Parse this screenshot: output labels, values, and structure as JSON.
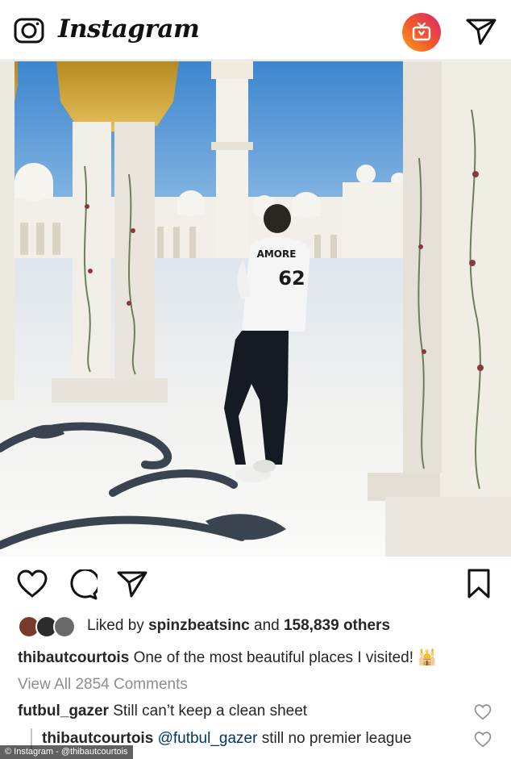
{
  "app": {
    "logo_text": "Instagram"
  },
  "post": {
    "likes": {
      "prefix": "Liked by",
      "user": "spinzbeatsinc",
      "and": "and",
      "count": "158,839 others"
    },
    "caption": {
      "user": "thibautcourtois",
      "text": "One of the most beautiful places I visited!",
      "emoji": "🕌"
    },
    "view_all": "View All 2854 Comments",
    "comments": [
      {
        "user": "futbul_gazer",
        "text": "Still can’t keep a clean sheet"
      },
      {
        "user": "thibautcourtois",
        "mention": "@futbul_gazer",
        "text": "still no premier league"
      }
    ],
    "photo": {
      "shirt_name": "AMORE",
      "shirt_number": "62"
    }
  },
  "watermark": "© Instagram - @thibautcourtois",
  "colors": {
    "igtv_gradient_start": "#f9a21b",
    "igtv_gradient_end": "#d8266f",
    "divider": "#dbdbdb",
    "muted": "#8e8e8e"
  },
  "icons": [
    "camera-icon",
    "igtv-icon",
    "direct-send-icon",
    "heart-icon",
    "comment-icon",
    "share-icon",
    "bookmark-icon"
  ]
}
